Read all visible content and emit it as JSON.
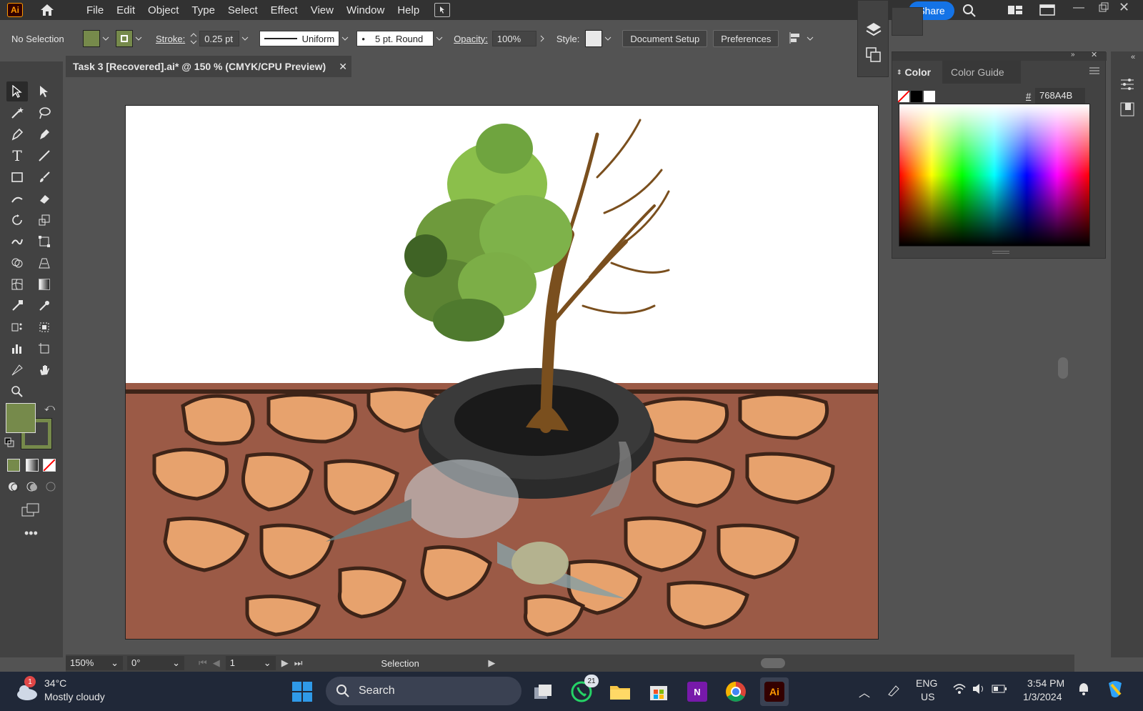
{
  "app": {
    "logo_text": "Ai",
    "menu": [
      "File",
      "Edit",
      "Object",
      "Type",
      "Select",
      "Effect",
      "View",
      "Window",
      "Help"
    ],
    "share_label": "Share"
  },
  "control_bar": {
    "selection_status": "No Selection",
    "fill_color": "#768A4B",
    "stroke_label": "Stroke:",
    "stroke_weight": "0.25 pt",
    "stroke_profile": "Uniform",
    "brush": "5 pt. Round",
    "opacity_label": "Opacity:",
    "opacity_value": "100%",
    "style_label": "Style:",
    "document_setup_label": "Document Setup",
    "preferences_label": "Preferences"
  },
  "document_tab": {
    "title": "Task 3 [Recovered].ai* @ 150 % (CMYK/CPU Preview)"
  },
  "color_panel": {
    "tab_color": "Color",
    "tab_color_guide": "Color Guide",
    "hex_label": "#",
    "hex_value": "768A4B"
  },
  "status_bar": {
    "zoom": "150%",
    "rotation": "0°",
    "artboard_number": "1",
    "tool_name": "Selection"
  },
  "taskbar": {
    "weather_temp": "34°C",
    "weather_desc": "Mostly cloudy",
    "weather_badge": "1",
    "search_label": "Search",
    "whatsapp_badge": "21",
    "lang_primary": "ENG",
    "lang_secondary": "US",
    "time": "3:54 PM",
    "date": "1/3/2024"
  }
}
